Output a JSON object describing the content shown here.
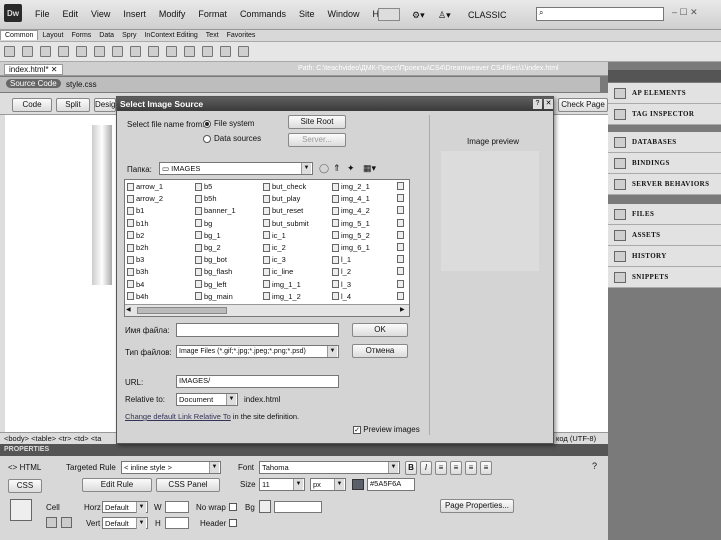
{
  "app": {
    "logo": "Dw"
  },
  "menu": [
    "File",
    "Edit",
    "View",
    "Insert",
    "Modify",
    "Format",
    "Commands",
    "Site",
    "Window",
    "Help"
  ],
  "workspace": "CLASSIC",
  "window_controls": "– ☐ ✕",
  "insert_tabs": [
    "Common",
    "Layout",
    "Forms",
    "Data",
    "Spry",
    "InContext Editing",
    "Text",
    "Favorites"
  ],
  "document": {
    "tab": "index.html*",
    "path": "Path:  C:\\teachvideo\\ДМК-Пресс\\Проекты\\CS4\\Dreamweaver CS4\\files\\1\\index.html",
    "source_code": "Source Code",
    "related_file": "style.css"
  },
  "view_buttons": {
    "code": "Code",
    "split": "Split",
    "design": "Design",
    "check_page": "Check Page"
  },
  "status": {
    "tags": "<body> <table> <tr> <td> <ta",
    "encoding": "код (UTF-8)"
  },
  "right_panel": {
    "group1": [
      "AP ELEMENTS",
      "TAG INSPECTOR"
    ],
    "group2": [
      "DATABASES",
      "BINDINGS",
      "SERVER BEHAVIORS"
    ],
    "group3": [
      "FILES",
      "ASSETS",
      "HISTORY",
      "SNIPPETS"
    ]
  },
  "dialog": {
    "title": "Select Image Source",
    "help": "?",
    "close": "✕",
    "select_from_label": "Select file name from:",
    "file_system": "File system",
    "data_sources": "Data sources",
    "site_root": "Site Root",
    "server": "Server...",
    "look_in_label": "Папка:",
    "folder": "IMAGES",
    "files": [
      [
        "arrow_1",
        "arrow_2",
        "b1",
        "b1h",
        "b2",
        "b2h",
        "b3",
        "b3h",
        "b4",
        "b4h"
      ],
      [
        "b5",
        "b5h",
        "banner_1",
        "bg",
        "bg_1",
        "bg_2",
        "bg_bot",
        "bg_flash",
        "bg_left",
        "bg_main"
      ],
      [
        "but_check",
        "but_play",
        "but_reset",
        "but_submit",
        "ic_1",
        "ic_2",
        "ic_3",
        "ic_line",
        "img_1_1",
        "img_1_2"
      ],
      [
        "img_2_1",
        "img_4_1",
        "img_4_2",
        "img_5_1",
        "img_5_2",
        "img_6_1",
        "l_1",
        "l_2",
        "l_3",
        "l_4"
      ]
    ],
    "filename_label": "Имя файла:",
    "filetype_label": "Тип файлов:",
    "filetype": "Image Files (*.gif;*.jpg;*.jpeg;*.png;*.psd)",
    "ok": "OK",
    "cancel": "Отмена",
    "url_label": "URL:",
    "url": "IMAGES/",
    "relative_label": "Relative to:",
    "relative": "Document",
    "relative_file": "index.html",
    "change_link": "Change default Link Relative To",
    "change_tail": " in the site definition.",
    "preview_title": "Image preview",
    "preview_images": "Preview images"
  },
  "properties": {
    "title": "PROPERTIES",
    "html": "<> HTML",
    "css": "CSS",
    "targeted_rule_label": "Targeted Rule",
    "targeted_rule": "< inline style >",
    "edit_rule": "Edit Rule",
    "css_panel": "CSS Panel",
    "font_label": "Font",
    "font": "Tahoma",
    "size_label": "Size",
    "size": "11",
    "unit": "px",
    "color": "#5A5F6A",
    "cell": "Cell",
    "horz_label": "Horz",
    "horz": "Default",
    "vert_label": "Vert",
    "vert": "Default",
    "w": "W",
    "h": "H",
    "nowrap": "No wrap",
    "bg": "Bg",
    "header": "Header",
    "page_properties": "Page Properties..."
  }
}
